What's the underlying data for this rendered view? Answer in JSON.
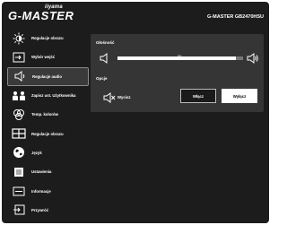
{
  "header": {
    "brand_small": "iiyama",
    "brand_main": "G-MASTER",
    "model": "G-MASTER GB2470HSU"
  },
  "sidebar": {
    "items": [
      {
        "label": "Regulacje obrazu",
        "icon": "brightness-icon"
      },
      {
        "label": "Wybór wejść",
        "icon": "input-select-icon"
      },
      {
        "label": "Regulacje audio",
        "icon": "speaker-icon",
        "active": true
      },
      {
        "label": "Zapisz ust. Użytkownika",
        "icon": "user-settings-icon"
      },
      {
        "label": "Temp. kolorów",
        "icon": "color-temp-icon"
      },
      {
        "label": "Regulacje obrazu",
        "icon": "image-adjust-icon"
      },
      {
        "label": "Język",
        "icon": "globe-icon"
      },
      {
        "label": "Ustawienia",
        "icon": "settings-icon"
      },
      {
        "label": "Informacje",
        "icon": "info-icon"
      },
      {
        "label": "Przywróć",
        "icon": "reset-icon"
      }
    ]
  },
  "panel": {
    "volume": {
      "title": "Głośność",
      "value": "50",
      "level": 0.5
    },
    "options": {
      "title": "Opcje",
      "mute_label": "Wycisz",
      "on_label": "Włącz",
      "off_label": "Wyłącz",
      "selected": "off"
    }
  },
  "colors": {
    "background": "#1c1c1c",
    "panel": "#353535",
    "active_item": "#3a3a3a",
    "text": "#ffffff"
  }
}
